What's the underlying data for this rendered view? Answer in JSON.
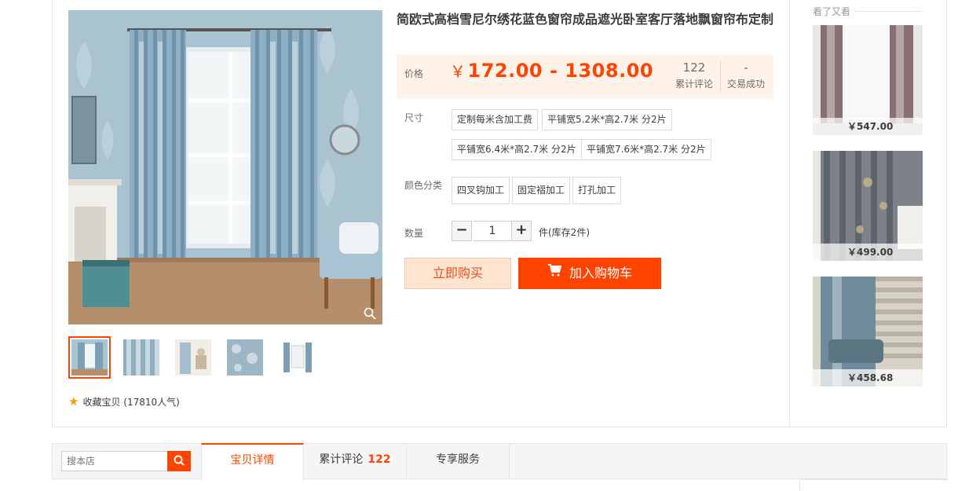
{
  "product": {
    "title": "简欧式高档雪尼尔绣花蓝色窗帘成品遮光卧室客厅落地飘窗帘布定制",
    "price_label": "价格",
    "price_currency": "￥",
    "price_range": "172.00 - 1308.00",
    "reviews_count": "122",
    "reviews_label": "累计评论",
    "deals_count": "-",
    "deals_label": "交易成功"
  },
  "size": {
    "label": "尺寸",
    "options": [
      "定制每米含加工费",
      "平铺宽5.2米*高2.7米 分2片",
      "平铺宽6.4米*高2.7米 分2片",
      "平铺宽7.6米*高2.7米 分2片"
    ]
  },
  "color": {
    "label": "颜色分类",
    "options": [
      "四叉钩加工",
      "固定褶加工",
      "打孔加工"
    ]
  },
  "quantity": {
    "label": "数量",
    "minus": "−",
    "plus": "+",
    "value": "1",
    "stock": "件(库存2件)"
  },
  "actions": {
    "buy_now": "立即购买",
    "add_to_cart": "加入购物车"
  },
  "favorite": {
    "label": "收藏宝贝 (17810人气)"
  },
  "side": {
    "title": "看了又看",
    "items": [
      {
        "price": "￥547.00"
      },
      {
        "price": "￥499.00"
      },
      {
        "price": "￥458.68"
      }
    ]
  },
  "bottom": {
    "search_placeholder": "搜本店",
    "tabs": [
      {
        "label": "宝贝详情"
      },
      {
        "label": "累计评论",
        "count": "122"
      },
      {
        "label": "专享服务"
      }
    ]
  },
  "colors": {
    "accent": "#ff4400",
    "price_bg": "#fff2e8",
    "curtain_blue": "#8fb0c4"
  }
}
